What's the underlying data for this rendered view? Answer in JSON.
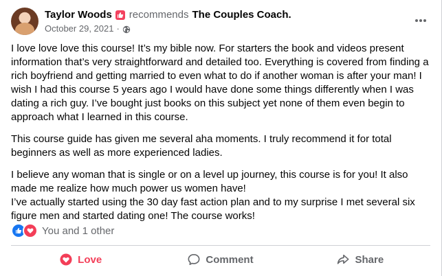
{
  "post": {
    "author": "Taylor Woods",
    "verb": "recommends",
    "page": "The Couples Coach.",
    "date": "October 29, 2021",
    "separator": "·",
    "privacy_icon": "globe-icon",
    "paragraphs": [
      "I love love love this course! It’s my bible now. For starters the book and videos present information that’s very straightforward and detailed too. Everything is covered from finding a rich boyfriend and getting married to even what to do if another woman is after your man! I wish I had this course 5 years ago I would have done some things differently when I was dating a rich guy. I’ve bought just books on this subject yet none of them even begin to approach what I learned in this course.",
      "This course guide has given me several aha moments. I truly recommend it for total beginners as well as more experienced ladies.",
      "I believe any woman that is single or on a level up journey, this course is for you! It also made me realize how much power us women have!",
      "I’ve actually started using the 30 day fast action plan and to my surprise I met several six figure men and started dating one! The course works!"
    ],
    "reactions_text": "You and 1 other",
    "reaction_icons": [
      "like-icon",
      "love-icon"
    ]
  },
  "actions": {
    "love": "Love",
    "comment": "Comment",
    "share": "Share"
  },
  "colors": {
    "love": "#f33e58",
    "like": "#1877f2",
    "recommend": "#f3425f",
    "secondary_text": "#65676b"
  }
}
